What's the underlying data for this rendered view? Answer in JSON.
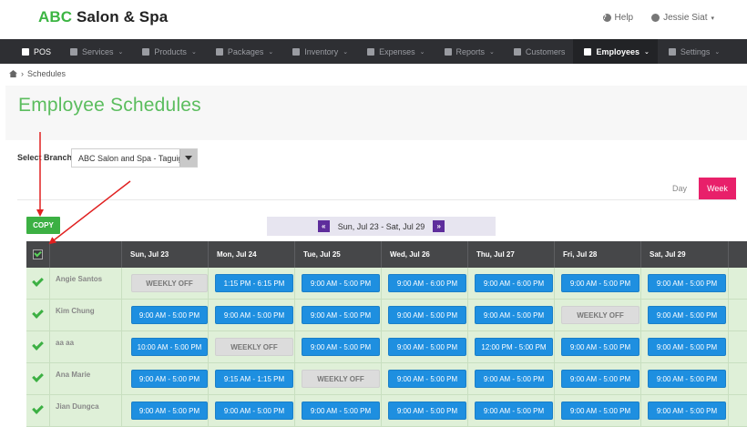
{
  "app": {
    "brand_prefix": "ABC",
    "brand_rest": "Salon & Spa"
  },
  "topright": {
    "help": "Help",
    "user": "Jessie Siat"
  },
  "nav": [
    {
      "label": "POS",
      "icon": "register-icon",
      "caret": false,
      "style": "pos"
    },
    {
      "label": "Services",
      "icon": "hand-icon",
      "caret": true,
      "style": ""
    },
    {
      "label": "Products",
      "icon": "cube-icon",
      "caret": true,
      "style": ""
    },
    {
      "label": "Packages",
      "icon": "tag-icon",
      "caret": true,
      "style": ""
    },
    {
      "label": "Inventory",
      "icon": "refresh-icon",
      "caret": true,
      "style": ""
    },
    {
      "label": "Expenses",
      "icon": "edit-icon",
      "caret": true,
      "style": ""
    },
    {
      "label": "Reports",
      "icon": "bar-chart-icon",
      "caret": true,
      "style": ""
    },
    {
      "label": "Customers",
      "icon": "users-icon",
      "caret": false,
      "style": ""
    },
    {
      "label": "Employees",
      "icon": "briefcase-icon",
      "caret": true,
      "style": "active"
    },
    {
      "label": "Settings",
      "icon": "gear-icon",
      "caret": true,
      "style": ""
    }
  ],
  "breadcrumb": {
    "separator": "›",
    "current": "Schedules"
  },
  "page": {
    "title": "Employee Schedules"
  },
  "branch": {
    "label": "Select Branch",
    "selected": "ABC Salon and Spa - Taguig"
  },
  "view": {
    "day": "Day",
    "week": "Week"
  },
  "copy_label": "COPY",
  "week_nav": {
    "prev": "«",
    "range": "Sun, Jul 23 - Sat, Jul 29",
    "next": "»"
  },
  "days": [
    "Sun, Jul 23",
    "Mon, Jul 24",
    "Tue, Jul 25",
    "Wed, Jul 26",
    "Thu, Jul 27",
    "Fri, Jul 28",
    "Sat, Jul 29"
  ],
  "employees": [
    {
      "name": "Angie Santos",
      "shifts": [
        "WEEKLY OFF",
        "1:15 PM - 6:15 PM",
        "9:00 AM - 5:00 PM",
        "9:00 AM - 6:00 PM",
        "9:00 AM - 6:00 PM",
        "9:00 AM - 5:00 PM",
        "9:00 AM - 5:00 PM"
      ]
    },
    {
      "name": "Kim Chung",
      "shifts": [
        "9:00 AM - 5:00 PM",
        "9:00 AM - 5:00 PM",
        "9:00 AM - 5:00 PM",
        "9:00 AM - 5:00 PM",
        "9:00 AM - 5:00 PM",
        "WEEKLY OFF",
        "9:00 AM - 5:00 PM"
      ]
    },
    {
      "name": "aa aa",
      "shifts": [
        "10:00 AM - 5:00 PM",
        "WEEKLY OFF",
        "9:00 AM - 5:00 PM",
        "9:00 AM - 5:00 PM",
        "12:00 PM - 5:00 PM",
        "9:00 AM - 5:00 PM",
        "9:00 AM - 5:00 PM"
      ]
    },
    {
      "name": "Ana Marie",
      "shifts": [
        "9:00 AM - 5:00 PM",
        "9:15 AM - 1:15 PM",
        "WEEKLY OFF",
        "9:00 AM - 5:00 PM",
        "9:00 AM - 5:00 PM",
        "9:00 AM - 5:00 PM",
        "9:00 AM - 5:00 PM"
      ]
    },
    {
      "name": "Jian Dungca",
      "shifts": [
        "9:00 AM - 5:00 PM",
        "9:00 AM - 5:00 PM",
        "9:00 AM - 5:00 PM",
        "9:00 AM - 5:00 PM",
        "9:00 AM - 5:00 PM",
        "9:00 AM - 5:00 PM",
        "9:00 AM - 5:00 PM"
      ]
    }
  ],
  "off_value": "WEEKLY OFF",
  "colors": {
    "brand_green": "#3cb543",
    "title_green": "#5bbd5e",
    "shift_blue": "#1e8fe0",
    "week_pink": "#e8206a",
    "nav_dark": "#2e2f33",
    "week_arrow_purple": "#5e2d9c",
    "annotation_red": "#e02020"
  }
}
